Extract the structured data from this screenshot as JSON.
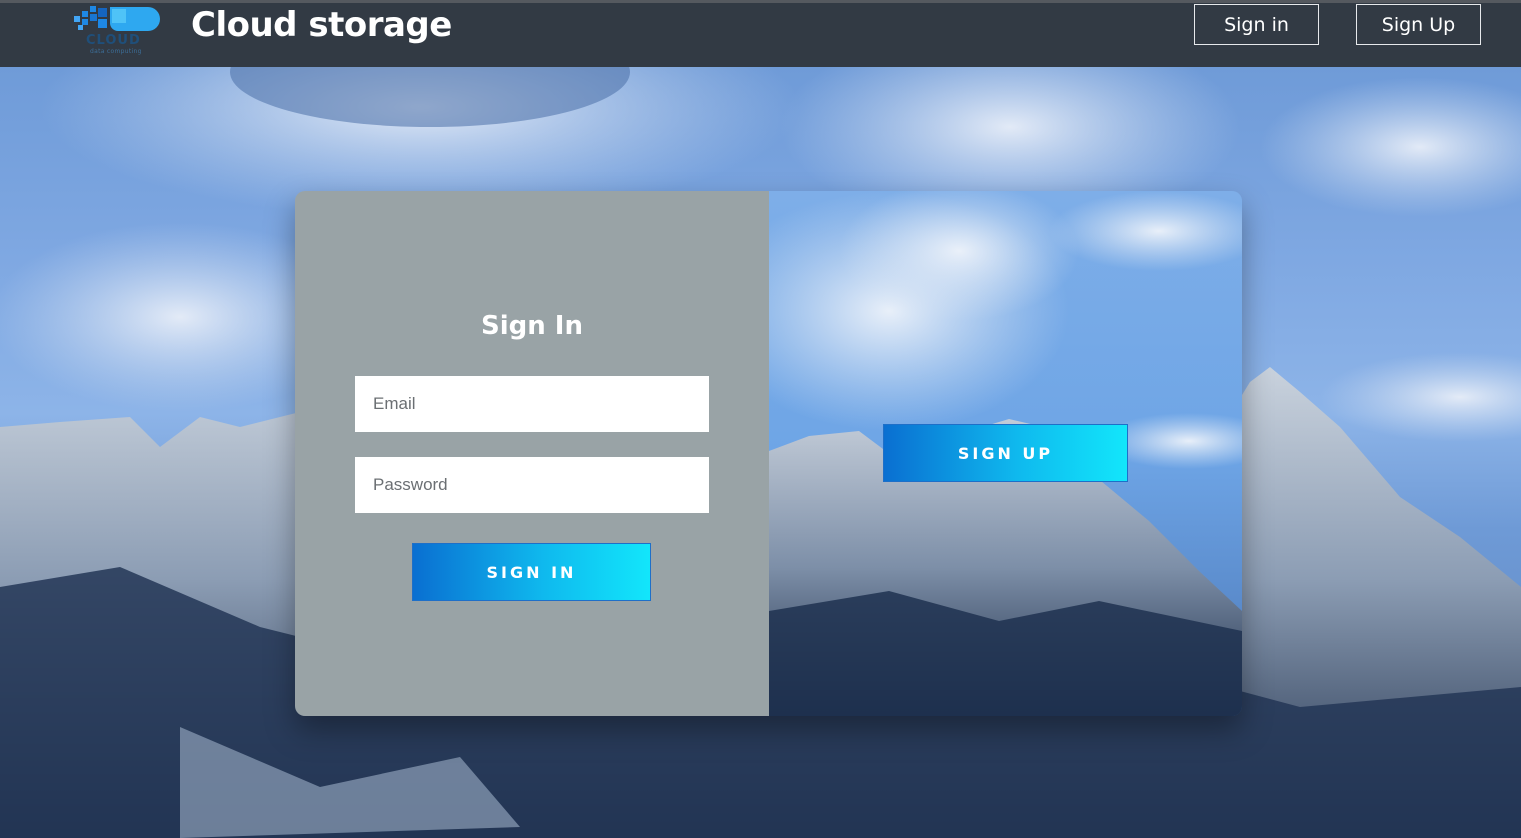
{
  "header": {
    "logo": {
      "word": "CLOUD",
      "tagline": "data computing"
    },
    "title": "Cloud storage",
    "nav": {
      "signin_label": "Sign in",
      "signup_label": "Sign Up"
    }
  },
  "form": {
    "title": "Sign In",
    "email_placeholder": "Email",
    "password_placeholder": "Password",
    "submit_label": "SIGN IN"
  },
  "overlay": {
    "signup_label": "SIGN UP"
  },
  "colors": {
    "header_bg": "#323a44",
    "panel_bg": "#99a3a6",
    "button_gradient_start": "#0a6fd1",
    "button_gradient_end": "#12e6fb"
  }
}
